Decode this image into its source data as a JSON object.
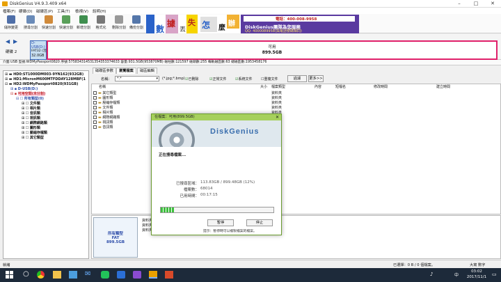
{
  "app": {
    "title": "DiskGenius V4.9.3.409 x64"
  },
  "menu": [
    "檔案(F)",
    "硬碟(D)",
    "磁碟區(P)",
    "工具(T)",
    "檢視(V)",
    "說明(H)"
  ],
  "toolbar": [
    "儲存變更",
    "搜尋分割",
    "快速分割",
    "快速分割",
    "新增分割",
    "格式化",
    "刪除分割",
    "備份分割"
  ],
  "banner": {
    "brand": "DiskGenius團隊為您服務",
    "phone": "電話：400-008-9958",
    "qq": "QQ: 4000089958(與電話號碼相同)",
    "chars": [
      "數",
      "據",
      "丟",
      "失",
      "怎",
      "麼",
      "辦"
    ]
  },
  "disknav": {
    "label": "硬碟 2",
    "part_name": "D-USB(D:)",
    "part_fs": "FAT32 (活動)",
    "part_size": "32.0GB",
    "free_label": "可用",
    "free_size": "899.5GB"
  },
  "diskinfo": "介面:USB  型號:WDMyPassport0820  序號:575834314531354353374633  容量:931.5GB(953870MB)  磁柱數:121597  磁頭數:255  每軌磁區數:63  總磁區數:1953458176",
  "tree": {
    "disks": [
      "HD0:ST1000DM003-9YN162(932GB)",
      "HD1:MicronM600MTFDDAY128MBF(1",
      "HD2:WDMyPassport0820(931GB)"
    ],
    "partition": "D-USB(D:)",
    "free": "可用空間(未分割)",
    "all_types": "所有類型(0)",
    "types": [
      "文件類",
      "相片類",
      "音訊類",
      "視訊類",
      "網際網路類",
      "圖形類",
      "壓縮存檔類",
      "其它類型"
    ]
  },
  "tabs": [
    "磁碟區參數",
    "瀏覽檔案",
    "磁區編輯"
  ],
  "filter": {
    "name_label": "名稱：",
    "name_value": "*.*",
    "ext_hint": "(*.jpg;*.bmp)",
    "checks": [
      "已刪除",
      "正常文件",
      "系統文件",
      "重複文件"
    ],
    "btn_filter": "過濾",
    "btn_more": "更多>>"
  },
  "filelist": {
    "columns": [
      "名稱",
      "大小",
      "檔案類型",
      "內容",
      "短檔名",
      "修改時間",
      "建立時間"
    ],
    "rows": [
      {
        "name": "其它類型",
        "type": "資料夾"
      },
      {
        "name": "圖形類",
        "type": "資料夾"
      },
      {
        "name": "壓縮存檔類",
        "type": "資料夾"
      },
      {
        "name": "文件類",
        "type": "資料夾"
      },
      {
        "name": "相片類",
        "type": "資料夾"
      },
      {
        "name": "網際網路類",
        "type": "資料夾"
      },
      {
        "name": "視訊類",
        "type": "資料夾"
      },
      {
        "name": "音訊類",
        "type": "資料夾"
      }
    ]
  },
  "bottom": {
    "name": "所有類型",
    "fs": "FAT",
    "size": "899.5GB",
    "label": "資料夾"
  },
  "dialog": {
    "title": "在檔案：可用(899.5GB)",
    "status": "正在搜尋檔案...",
    "searched_label": "已搜尋區域：",
    "searched_value": "113.83GB / 899.48GB (12%)",
    "files_label": "檔案數：",
    "files_value": "68014",
    "time_label": "已用時間：",
    "time_value": "00:17:15",
    "progress": 0.12,
    "btn_pause": "暫停",
    "btn_stop": "停止",
    "hint": "提示：暫停時可以複製檔案的檔案。"
  },
  "statusbar": {
    "left": "就緒",
    "right": "已選擇：0 B / 0 個檔案。",
    "mode": "大寫 數字"
  },
  "taskbar": {
    "time": "03:02",
    "date": "2017/11/1",
    "lang": "中"
  }
}
